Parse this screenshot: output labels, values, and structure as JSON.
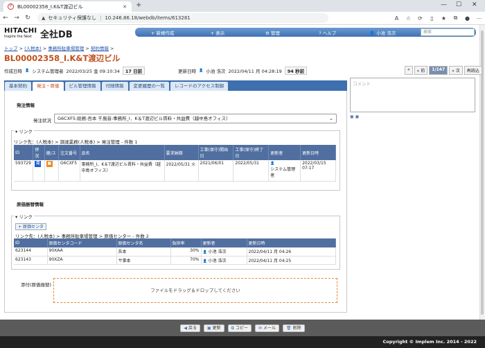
{
  "browser": {
    "tab_title": "BL00002358_I.K&T渡辺ビル",
    "security_label": "セキュリティ保護なし",
    "url": "10.246.86.18/webdb/items/613281"
  },
  "app": {
    "logo_main": "HITACHI",
    "logo_sub": "Inspire the Next",
    "db_name": "全社DB",
    "menu": [
      "+ 新規作成",
      "+ 表示",
      "⚙ 管理",
      "? ヘルプ",
      "👤 小池 浩次"
    ],
    "search_placeholder": "検索"
  },
  "breadcrumb": [
    "トップ",
    ">",
    "(人税本)",
    ">",
    "事務所駐車場管理",
    ">",
    "契約情報",
    ">"
  ],
  "page_title": "BL00002358_I.K&T渡辺ビル",
  "meta": {
    "created_label": "作成日時",
    "created_user": "システム管理者",
    "created_at": "2022/03/25 金 09:10:34",
    "created_ago": "17 日前",
    "updated_label": "更新日時",
    "updated_user": "小池 浩次",
    "updated_at": "2022/04/11 月 04:28:19",
    "updated_ago": "94 秒前"
  },
  "pager": {
    "first": "«",
    "prev": "« 前",
    "current": "1/147",
    "next": "» 次",
    "reload": "再読込"
  },
  "tabs": [
    "基本契約",
    "発注・原価",
    "ビル管理情報",
    "付随情報",
    "変更履歴の一覧",
    "レコードのアクセス制御"
  ],
  "comment_placeholder": "コメント",
  "order": {
    "section_title": "発注情報",
    "status_label": "発注状況",
    "status_value": "G6CXF5:総務:吾本 千風音:事務所_I．K＆T渡辺ビル賃料・共益費（越中島オフィス）",
    "link_legend": "リンク",
    "link_path": "リンク先：(人税本) > 調達業務(人税本) > 発注管理 - 件数 1",
    "columns": [
      "ID",
      "併況",
      "継/ス",
      "注文番号",
      "品名",
      "要求納期",
      "工事(保守)開始日",
      "工事(保守)終了日",
      "更新者",
      "更新日時"
    ],
    "rows": [
      {
        "id": "593729",
        "b1": "完",
        "b2": "■",
        "order_no": "G6CXF5",
        "name": "事務所_I．K＆T渡辺ビル賃料・共益費（越中島オフィス）",
        "due": "2022/05/31 火",
        "start": "2021/06/01",
        "end": "2022/05/31",
        "updater": "システム管理者",
        "updated": "2022/03/15 07:17"
      }
    ]
  },
  "cost": {
    "section_title": "原価振替情報",
    "link_legend": "リンク",
    "add_button": "+ 原価センタ",
    "link_path": "リンク先：(人税本) > 事務所駐車場管理 > 原価センター - 件数 2",
    "columns": [
      "ID",
      "原価センタコード",
      "原価センタ名",
      "負担率",
      "更新者",
      "更新日時"
    ],
    "rows": [
      {
        "id": "623144",
        "code": "90XAA",
        "name": "吾本",
        "rate": "30%",
        "updater": "小池 浩次",
        "updated": "2022/04/11 月 04:26"
      },
      {
        "id": "623143",
        "code": "90XZA",
        "name": "サ事本",
        "rate": "70%",
        "updater": "小池 浩次",
        "updated": "2022/04/11 月 04:25"
      }
    ]
  },
  "attach": {
    "label": "添付(原価振替)",
    "drop_text": "ファイルをドラッグ＆ドロップしてください"
  },
  "footer": {
    "buttons": [
      "戻る",
      "更新",
      "コピー",
      "メール",
      "削除"
    ],
    "copyright": "Copyright © Implem Inc. 2014 - 2022"
  }
}
